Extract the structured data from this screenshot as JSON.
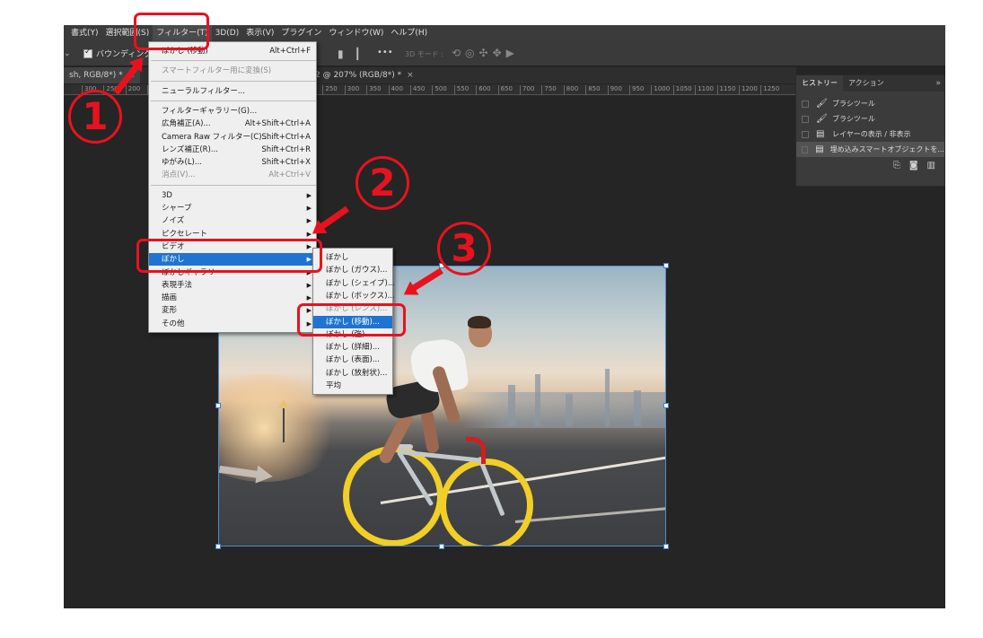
{
  "menubar": {
    "items": [
      "書式(Y)",
      "選択範囲(S)",
      "フィルター(T)",
      "3D(D)",
      "表示(V)",
      "プラグイン",
      "ウィンドウ(W)",
      "ヘルプ(H)"
    ],
    "active_index": 2
  },
  "options_bar": {
    "bounding_label": "バウンディングボックスを表示",
    "mode_3d": "3D モード :",
    "more": "•••"
  },
  "tabs": [
    {
      "label": "sh, RGB/8*) *",
      "close": "×"
    },
    {
      "label": "2 @ 207% (RGB/8*) *",
      "close": "×"
    }
  ],
  "ruler_ticks": [
    "300",
    "250",
    "200",
    "150",
    "100",
    "50",
    "0",
    "50",
    "100",
    "150",
    "200",
    "250",
    "300",
    "350",
    "400",
    "450",
    "500",
    "550",
    "600",
    "650",
    "700",
    "750",
    "800",
    "850",
    "900",
    "950",
    "1000",
    "1050",
    "1100",
    "1150",
    "1200",
    "1250"
  ],
  "filter_menu": {
    "items": [
      {
        "label": "ぼかし (移動)",
        "shortcut": "Alt+Ctrl+F",
        "type": "item"
      },
      {
        "type": "sep"
      },
      {
        "label": "スマートフィルター用に変換(S)",
        "type": "item",
        "disabled": true
      },
      {
        "type": "sep"
      },
      {
        "label": "ニューラルフィルター...",
        "type": "item"
      },
      {
        "type": "sep"
      },
      {
        "label": "フィルターギャラリー(G)...",
        "type": "item"
      },
      {
        "label": "広角補正(A)...",
        "shortcut": "Alt+Shift+Ctrl+A",
        "type": "item"
      },
      {
        "label": "Camera Raw フィルター(C)...",
        "shortcut": "Shift+Ctrl+A",
        "type": "item"
      },
      {
        "label": "レンズ補正(R)...",
        "shortcut": "Shift+Ctrl+R",
        "type": "item"
      },
      {
        "label": "ゆがみ(L)...",
        "shortcut": "Shift+Ctrl+X",
        "type": "item"
      },
      {
        "label": "消点(V)...",
        "shortcut": "Alt+Ctrl+V",
        "type": "item",
        "disabled": true
      },
      {
        "type": "sep"
      },
      {
        "label": "3D",
        "type": "sub"
      },
      {
        "label": "シャープ",
        "type": "sub"
      },
      {
        "label": "ノイズ",
        "type": "sub"
      },
      {
        "label": "ピクセレート",
        "type": "sub"
      },
      {
        "label": "ビデオ",
        "type": "sub"
      },
      {
        "label": "ぼかし",
        "type": "sub",
        "highlight": true
      },
      {
        "label": "ぼかしギャラリー",
        "type": "sub"
      },
      {
        "label": "表現手法",
        "type": "sub"
      },
      {
        "label": "描画",
        "type": "sub"
      },
      {
        "label": "変形",
        "type": "sub"
      },
      {
        "label": "その他",
        "type": "sub"
      }
    ]
  },
  "blur_submenu": {
    "items": [
      {
        "label": "ぼかし"
      },
      {
        "label": "ぼかし (ガウス)..."
      },
      {
        "label": "ぼかし (シェイプ)..."
      },
      {
        "label": "ぼかし (ボックス)..."
      },
      {
        "label": "ぼかし (レンズ)...",
        "disabled": true
      },
      {
        "label": "ぼかし (移動)...",
        "highlight": true
      },
      {
        "label": "ぼかし (強)"
      },
      {
        "label": "ぼかし (詳細)..."
      },
      {
        "label": "ぼかし (表面)..."
      },
      {
        "label": "ぼかし (放射状)..."
      },
      {
        "label": "平均"
      }
    ]
  },
  "history_panel": {
    "tabs": [
      "ヒストリー",
      "アクション"
    ],
    "more": "»",
    "rows": [
      {
        "icon": "brush-icon",
        "label": "ブラシツール"
      },
      {
        "icon": "brush-icon",
        "label": "ブラシツール"
      },
      {
        "icon": "document-icon",
        "label": "レイヤーの表示 / 非表示"
      },
      {
        "icon": "document-icon",
        "label": "埋め込みスマートオブジェクトを..."
      }
    ],
    "footer_icons": [
      "new-doc-from-state-icon",
      "camera-icon",
      "trash-icon"
    ]
  },
  "annotations": {
    "numbers": [
      "1",
      "2",
      "3"
    ],
    "color": "#e8121f"
  }
}
